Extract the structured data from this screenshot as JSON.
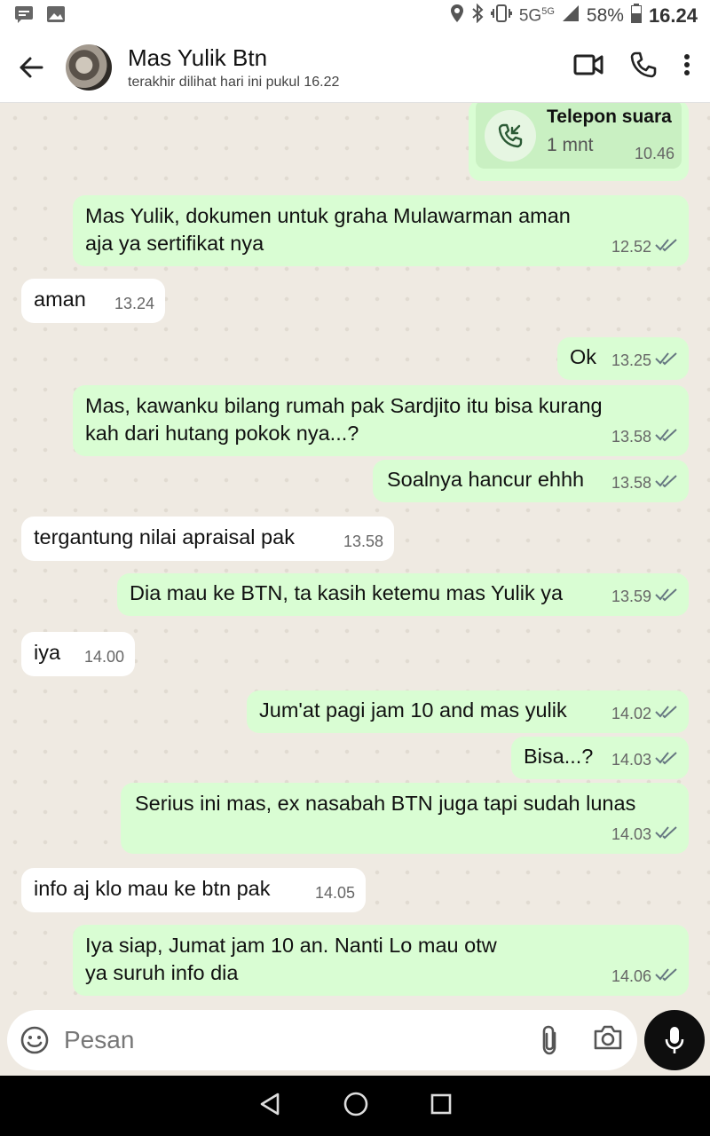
{
  "status_bar": {
    "battery": "58%",
    "time": "16.24",
    "network": "5G",
    "network_sup": "5G"
  },
  "header": {
    "contact_name": "Mas Yulik Btn",
    "last_seen": "terakhir dilihat hari ini pukul 16.22"
  },
  "call": {
    "title": "Telepon suara",
    "duration": "1 mnt",
    "time": "10.46"
  },
  "messages": [
    {
      "text": "Mas Yulik, dokumen untuk graha Mulawarman aman\naja ya sertifikat nya",
      "time": "12.52",
      "dir": "out"
    },
    {
      "text": "aman",
      "time": "13.24",
      "dir": "in"
    },
    {
      "text": "Ok",
      "time": "13.25",
      "dir": "out"
    },
    {
      "text": "Mas, kawanku bilang rumah pak Sardjito itu bisa kurang\nkah dari hutang pokok nya...?",
      "time": "13.58",
      "dir": "out"
    },
    {
      "text": "Soalnya hancur ehhh",
      "time": "13.58",
      "dir": "out"
    },
    {
      "text": "tergantung nilai apraisal pak",
      "time": "13.58",
      "dir": "in"
    },
    {
      "text": "Dia mau ke BTN, ta kasih ketemu mas Yulik ya",
      "time": "13.59",
      "dir": "out"
    },
    {
      "text": "iya",
      "time": "14.00",
      "dir": "in"
    },
    {
      "text": "Jum'at pagi jam 10 and mas yulik",
      "time": "14.02",
      "dir": "out"
    },
    {
      "text": "Bisa...?",
      "time": "14.03",
      "dir": "out"
    },
    {
      "text": "Serius ini mas, ex nasabah BTN juga tapi sudah lunas",
      "time": "14.03",
      "dir": "out"
    },
    {
      "text": "info aj klo mau ke btn pak",
      "time": "14.05",
      "dir": "in"
    },
    {
      "text": "Iya siap, Jumat jam 10 an. Nanti Lo mau otw\nya suruh info dia",
      "time": "14.06",
      "dir": "out"
    }
  ],
  "composer": {
    "placeholder": "Pesan"
  },
  "colors": {
    "outgoing": "#d9fdd3",
    "incoming": "#ffffff",
    "chat_bg": "#efeae2",
    "read_tick": "#667781"
  }
}
